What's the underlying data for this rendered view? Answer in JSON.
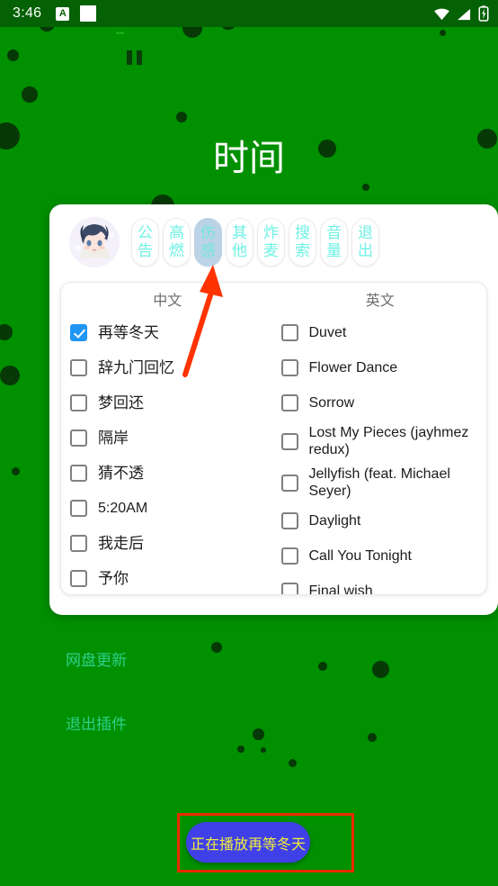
{
  "status_bar": {
    "time": "3:46",
    "icon_a_label": "A",
    "icons": [
      "letter-a-badge",
      "white-square",
      "wifi-icon",
      "signal-icon",
      "battery-charging-icon"
    ]
  },
  "background": {
    "color": "#009000",
    "tiny_text": "•••",
    "pause_icon": "pause-icon"
  },
  "overlay": {
    "title": "时间",
    "links": [
      {
        "label": "网盘更新"
      },
      {
        "label": "退出插件"
      }
    ]
  },
  "dialog": {
    "avatar": "anime-character-avatar",
    "tabs": [
      {
        "label": "公告",
        "chars": [
          "公",
          "告"
        ],
        "selected": false
      },
      {
        "label": "高燃",
        "chars": [
          "高",
          "燃"
        ],
        "selected": false
      },
      {
        "label": "伤感",
        "chars": [
          "伤",
          "感"
        ],
        "selected": true
      },
      {
        "label": "其他",
        "chars": [
          "其",
          "他"
        ],
        "selected": false
      },
      {
        "label": "炸麦",
        "chars": [
          "炸",
          "麦"
        ],
        "selected": false
      },
      {
        "label": "搜索",
        "chars": [
          "搜",
          "索"
        ],
        "selected": false
      },
      {
        "label": "音量",
        "chars": [
          "音",
          "量"
        ],
        "selected": false
      },
      {
        "label": "退出",
        "chars": [
          "退",
          "出"
        ],
        "selected": false
      }
    ],
    "columns": [
      {
        "header": "中文",
        "items": [
          {
            "label": "再等冬天",
            "checked": true
          },
          {
            "label": "辞九门回忆",
            "checked": false
          },
          {
            "label": "梦回还",
            "checked": false
          },
          {
            "label": "隔岸",
            "checked": false
          },
          {
            "label": "猜不透",
            "checked": false
          },
          {
            "label": "5:20AM",
            "checked": false
          },
          {
            "label": "我走后",
            "checked": false
          },
          {
            "label": "予你",
            "checked": false
          }
        ]
      },
      {
        "header": "英文",
        "items": [
          {
            "label": "Duvet",
            "checked": false
          },
          {
            "label": "Flower Dance",
            "checked": false
          },
          {
            "label": "Sorrow",
            "checked": false
          },
          {
            "label": "Lost My Pieces (jayhmez redux)",
            "checked": false
          },
          {
            "label": "Jellyfish (feat. Michael Seyer)",
            "checked": false
          },
          {
            "label": "Daylight",
            "checked": false
          },
          {
            "label": "Call You Tonight",
            "checked": false
          },
          {
            "label": "Final wish",
            "checked": false
          }
        ]
      }
    ]
  },
  "play_button": {
    "label": "正在播放再等冬天",
    "bg_color": "#4040e8",
    "text_color": "#f2ef3a",
    "highlight_color": "#e82b00"
  },
  "annotation": {
    "arrow_color": "#ff3300",
    "points_to": "伤感"
  },
  "colors": {
    "background": "#009000",
    "status_bar": "#046104",
    "accent_checkbox": "#2196F3",
    "tab_text": "#6ff2e4",
    "tab_selected_bg": "#bcd3e6",
    "link_text": "#2fd08a"
  }
}
